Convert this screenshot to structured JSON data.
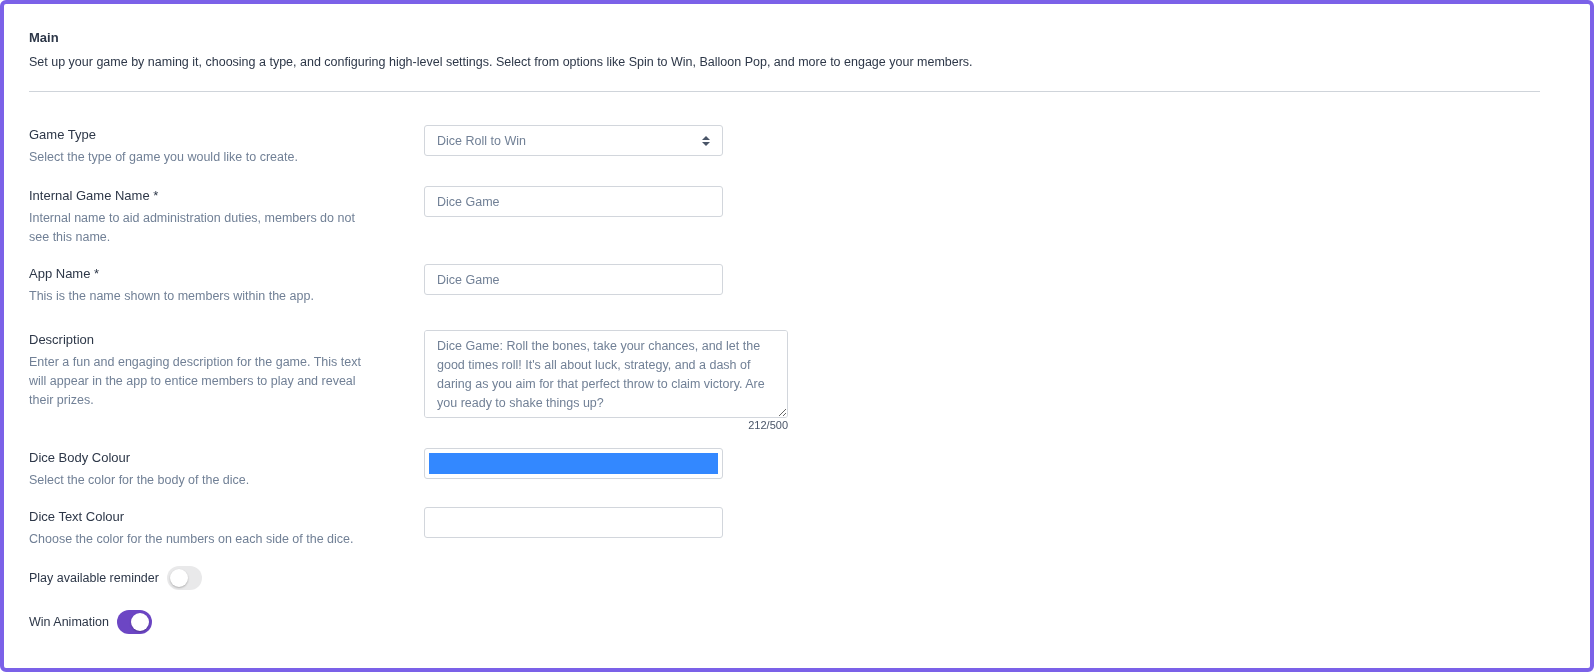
{
  "section": {
    "title": "Main",
    "description": "Set up your game by naming it, choosing a type, and configuring high-level settings. Select from options like Spin to Win, Balloon Pop, and more to engage your members."
  },
  "fields": [
    {
      "kind": "select",
      "label": "Game Type",
      "help": "Select the type of game you would like to create.",
      "value": "Dice Roll to Win"
    },
    {
      "kind": "text",
      "label": "Internal Game Name *",
      "help": "Internal name to aid administration duties, members do not see this name.",
      "value": "Dice Game"
    },
    {
      "kind": "text",
      "label": "App Name *",
      "help": "This is the name shown to members within the app.",
      "value": "Dice Game"
    },
    {
      "kind": "textarea",
      "label": "Description",
      "help": "Enter a fun and engaging description for the game. This text will appear in the app to entice members to play and reveal their prizes.",
      "value": "Dice Game: Roll the bones, take your chances, and let the good times roll! It's all about luck, strategy, and a dash of daring as you aim for that perfect throw to claim victory. Are you ready to shake things up?",
      "counter": "212/500"
    },
    {
      "kind": "color",
      "label": "Dice Body Colour",
      "help": "Select the color for the body of the dice.",
      "color": "#3388ff"
    },
    {
      "kind": "color",
      "label": "Dice Text Colour",
      "help": "Choose the color for the numbers on each side of the dice."
    }
  ],
  "toggles": [
    {
      "label": "Play available reminder",
      "on": false
    },
    {
      "label": "Win Animation",
      "on": true
    }
  ]
}
